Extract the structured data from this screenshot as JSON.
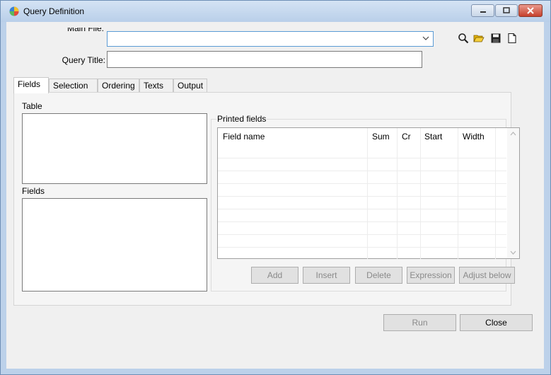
{
  "window": {
    "title": "Query Definition",
    "controls": {
      "minimize": "minimize",
      "restore": "restore",
      "close": "close"
    }
  },
  "header": {
    "main_file_label": "Main File:",
    "main_file_value": "",
    "query_title_label": "Query Title:",
    "query_title_value": "",
    "toolbar_icons": [
      "search-icon",
      "open-folder-icon",
      "save-icon",
      "new-document-icon"
    ]
  },
  "tabs": [
    {
      "label": "Fields",
      "active": true
    },
    {
      "label": "Selection",
      "active": false
    },
    {
      "label": "Ordering",
      "active": false
    },
    {
      "label": "Texts",
      "active": false
    },
    {
      "label": "Output",
      "active": false
    }
  ],
  "fields_tab": {
    "table_label": "Table",
    "fields_label": "Fields",
    "printed_fields_label": "Printed fields",
    "columns": [
      "Field name",
      "Sum",
      "Cr",
      "Start",
      "Width"
    ],
    "rows": [],
    "buttons": {
      "add": "Add",
      "insert": "Insert",
      "delete": "Delete",
      "expression": "Expression",
      "adjust_below": "Adjust below"
    }
  },
  "footer": {
    "run": "Run",
    "close": "Close"
  }
}
